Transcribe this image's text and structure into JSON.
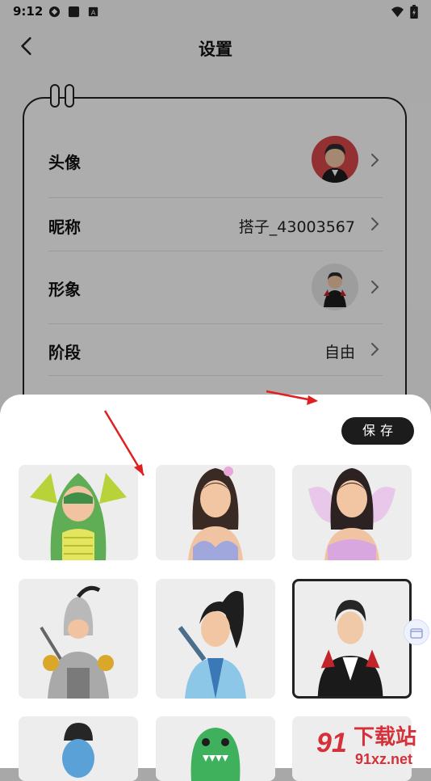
{
  "status_bar": {
    "time": "9:12"
  },
  "header": {
    "title": "设置"
  },
  "profile": {
    "rows": [
      {
        "label": "头像",
        "value": ""
      },
      {
        "label": "昵称",
        "value": "搭子_43003567"
      },
      {
        "label": "形象",
        "value": ""
      },
      {
        "label": "阶段",
        "value": "自由"
      }
    ]
  },
  "sheet": {
    "save_label": "保存",
    "avatars": [
      "dragon",
      "mermaid",
      "fairy",
      "knight",
      "swordsman",
      "vampire",
      "blue-face",
      "dino"
    ],
    "selected": "vampire"
  },
  "watermark": {
    "text": "下载站",
    "domain": "91xz.net"
  },
  "colors": {
    "accent": "#1c1c1c",
    "arrow": "#e02020",
    "watermark": "#d6303a"
  }
}
